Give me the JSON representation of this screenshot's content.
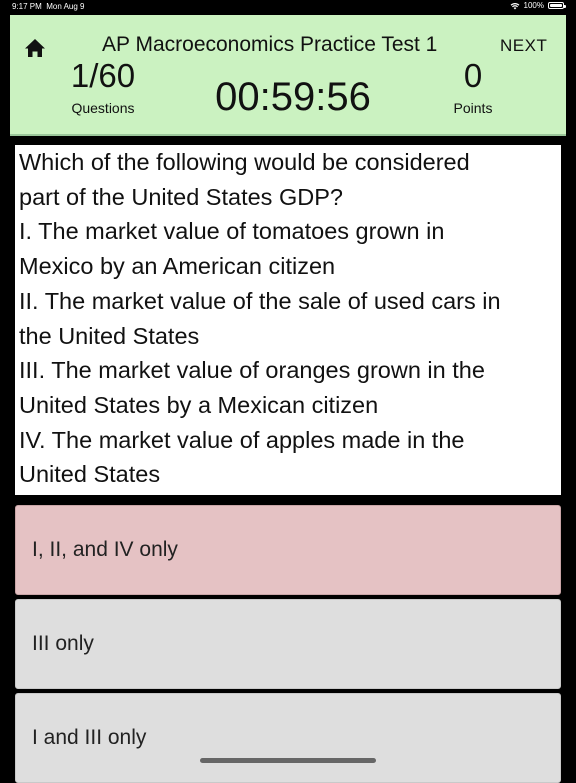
{
  "status_bar": {
    "time": "9:17 PM",
    "date": "Mon Aug 9",
    "battery": "100%"
  },
  "header": {
    "title": "AP Macroeconomics Practice Test 1",
    "next_label": "NEXT",
    "question_progress": "1/60",
    "question_label": "Questions",
    "timer": "00:59:56",
    "points": "0",
    "points_label": "Points",
    "home_icon": "home-icon"
  },
  "question": {
    "lines": [
      "Which of the following would be considered",
      "part of the United States GDP?",
      "I. The market value of tomatoes grown in",
      "Mexico by an American citizen",
      "II. The market value of the sale of used cars in",
      "the United States",
      "III. The market value of oranges grown in the",
      "United States by a Mexican citizen",
      "IV. The market value of apples made in the",
      "United States"
    ]
  },
  "answers": [
    {
      "text": "I, II, and IV only",
      "state": "selected"
    },
    {
      "text": "III only",
      "state": "default"
    },
    {
      "text": "I and III only",
      "state": "default"
    }
  ],
  "colors": {
    "header_bg": "#cbf2c1",
    "selected_answer_bg": "#e5c2c4",
    "answer_bg": "#dedede"
  }
}
